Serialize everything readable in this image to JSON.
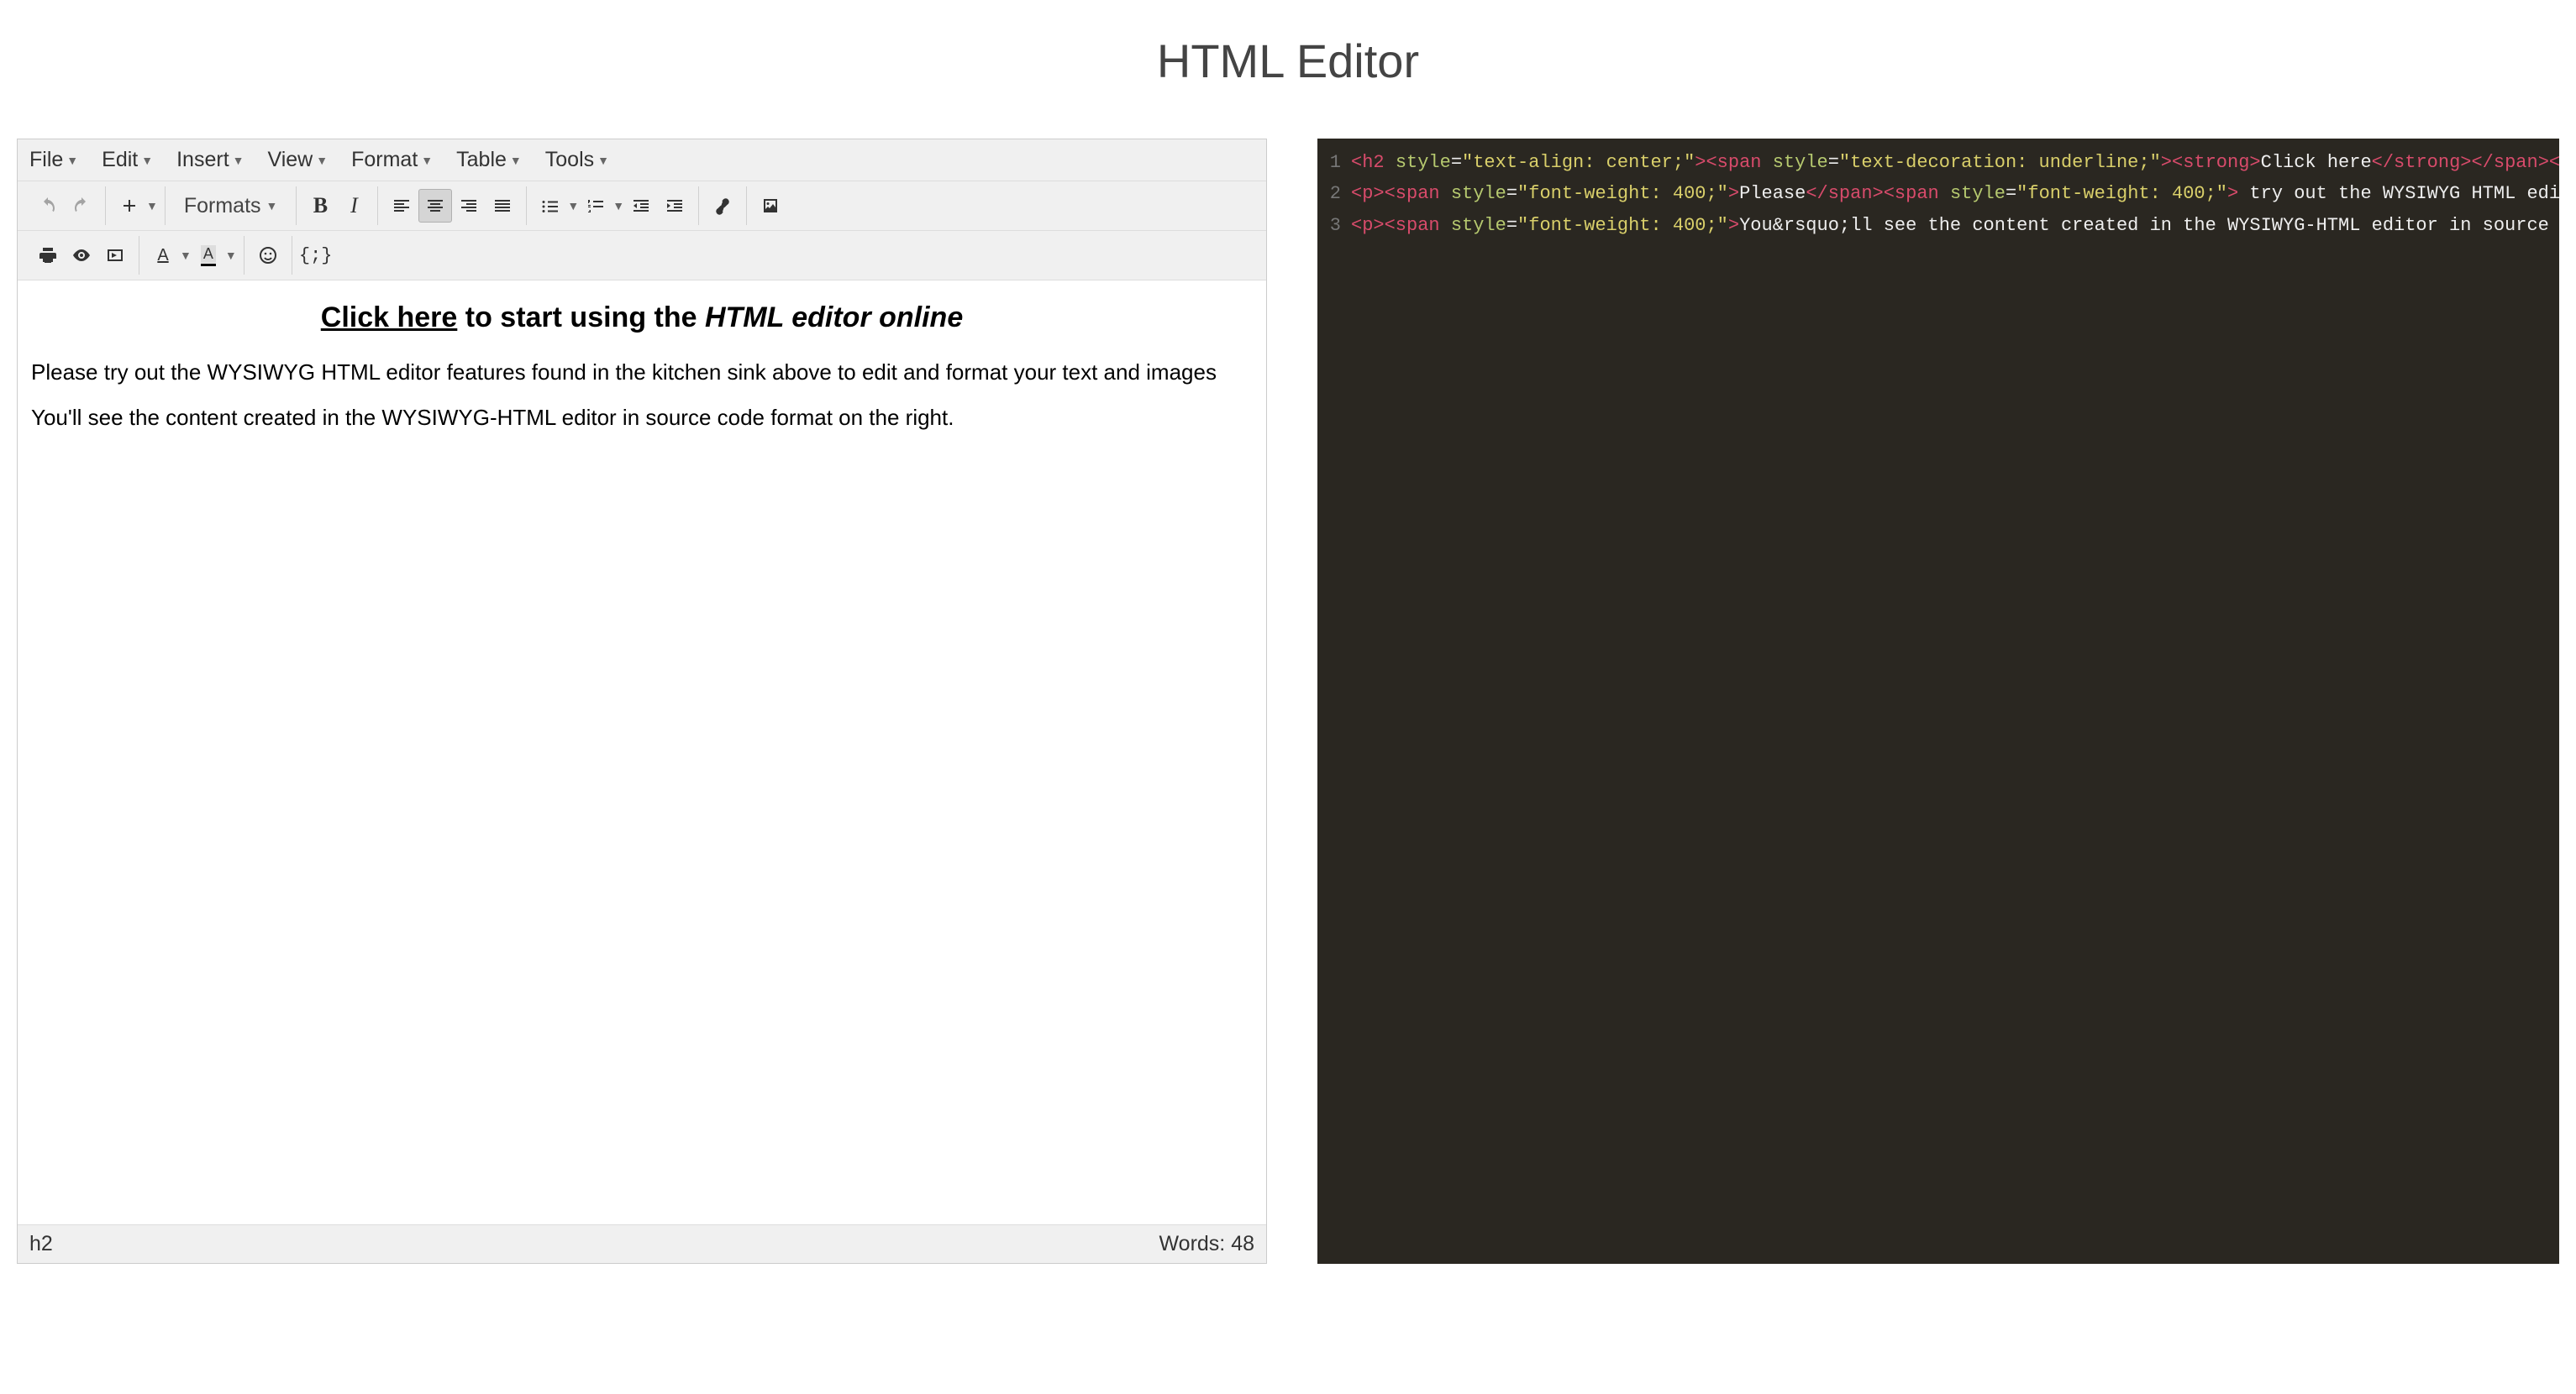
{
  "page_title": "HTML Editor",
  "menubar": {
    "file": "File",
    "edit": "Edit",
    "insert": "Insert",
    "view": "View",
    "format": "Format",
    "table": "Table",
    "tools": "Tools"
  },
  "toolbar": {
    "formats_label": "Formats"
  },
  "content": {
    "heading_click_here": "Click here",
    "heading_rest_before": " to start using the ",
    "heading_em": "HTML editor online",
    "para1": "Please try out the WYSIWYG HTML editor features found in the kitchen sink above to edit and format your text and images",
    "para2": "You'll see the content created in the WYSIWYG-HTML editor in source code format on the right."
  },
  "statusbar": {
    "path": "h2",
    "words_label": "Words: ",
    "words_value": "48"
  },
  "source": {
    "line_numbers": [
      "1",
      "2",
      "3"
    ],
    "line1": {
      "t1": "<h2 ",
      "a1": "style",
      "eq1": "=",
      "v1": "\"text-align: center;\"",
      "t2": "><span ",
      "a2": "style",
      "eq2": "=",
      "v2": "\"text-decoration: underline;\"",
      "t3": "><strong>",
      "tx1": "Click here",
      "t4": "</strong></span><stro"
    },
    "line2": {
      "t1": "<p><span ",
      "a1": "style",
      "eq1": "=",
      "v1": "\"font-weight: 400;\"",
      "t2": ">",
      "tx1": "Please",
      "t3": "</span><span ",
      "a2": "style",
      "eq2": "=",
      "v2": "\"font-weight: 400;\"",
      "t4": ">",
      "tx2": " try out the WYSIWYG HTML editor f"
    },
    "line3": {
      "t1": "<p><span ",
      "a1": "style",
      "eq1": "=",
      "v1": "\"font-weight: 400;\"",
      "t2": ">",
      "tx1": "You&rsquo;ll see the content created in the WYSIWYG-HTML editor in source code "
    }
  }
}
